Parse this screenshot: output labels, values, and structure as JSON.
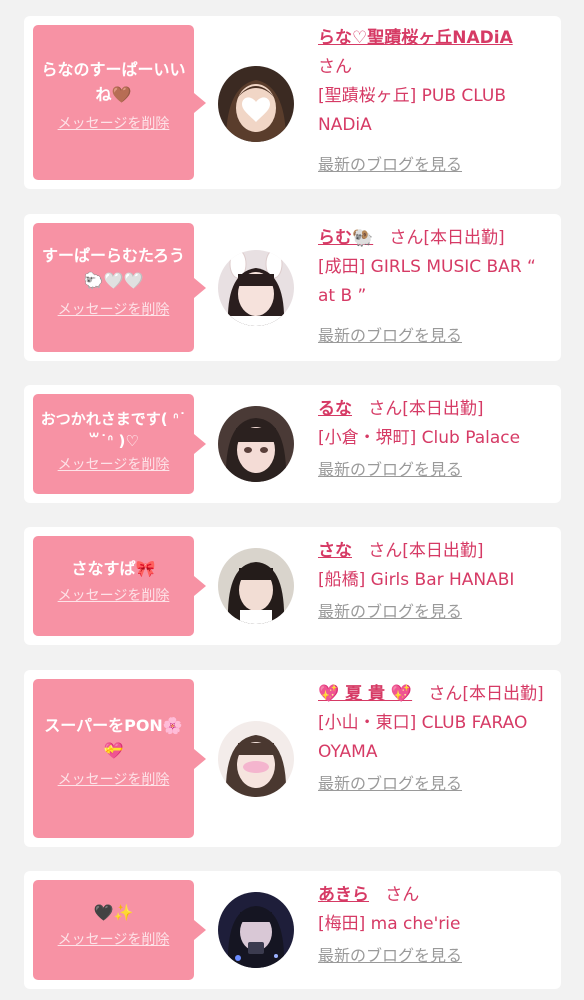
{
  "cards": [
    {
      "message": "らなのすーぱーいいね🤎",
      "delete_label": "メッセージを削除",
      "name": "らな♡聖蹟桜ヶ丘NADiA",
      "honorific": "さん",
      "status": "",
      "shop": "[聖蹟桜ヶ丘] PUB CLUB NADiA",
      "blog_link": "最新のブログを見る"
    },
    {
      "message": "すーぱーらむたろう🐑🤍🤍",
      "delete_label": "メッセージを削除",
      "name": "らむ🐏",
      "honorific": "さん",
      "status": "[本日出勤]",
      "shop": "[成田] GIRLS MUSIC BAR “ at B ”",
      "blog_link": "最新のブログを見る"
    },
    {
      "message": "おつかれさまです( ᐢ˙꒳˙ᐢ )♡",
      "delete_label": "メッセージを削除",
      "name": "るな",
      "honorific": "さん",
      "status": "[本日出勤]",
      "shop": "[小倉・堺町] Club Palace",
      "blog_link": "最新のブログを見る"
    },
    {
      "message": "さなすぱ🎀",
      "delete_label": "メッセージを削除",
      "name": "さな",
      "honorific": "さん",
      "status": "[本日出勤]",
      "shop": "[船橋] Girls Bar HANABI",
      "blog_link": "最新のブログを見る"
    },
    {
      "message": "スーパーをPON🌸💝",
      "delete_label": "メッセージを削除",
      "name": "💖 夏 貴 💖",
      "honorific": "さん",
      "status": "[本日出勤]",
      "shop": "[小山・東口] CLUB FARAO OYAMA",
      "blog_link": "最新のブログを見る"
    },
    {
      "message": "🖤✨",
      "delete_label": "メッセージを削除",
      "name": "あきら",
      "honorific": "さん",
      "status": "",
      "shop": "[梅田] ma che'rie",
      "blog_link": "最新のブログを見る"
    }
  ],
  "colors": {
    "bubble": "#f792a4",
    "accent_text": "#d63a65",
    "link_gray": "#9a9a9a",
    "background": "#f2f2f2"
  }
}
